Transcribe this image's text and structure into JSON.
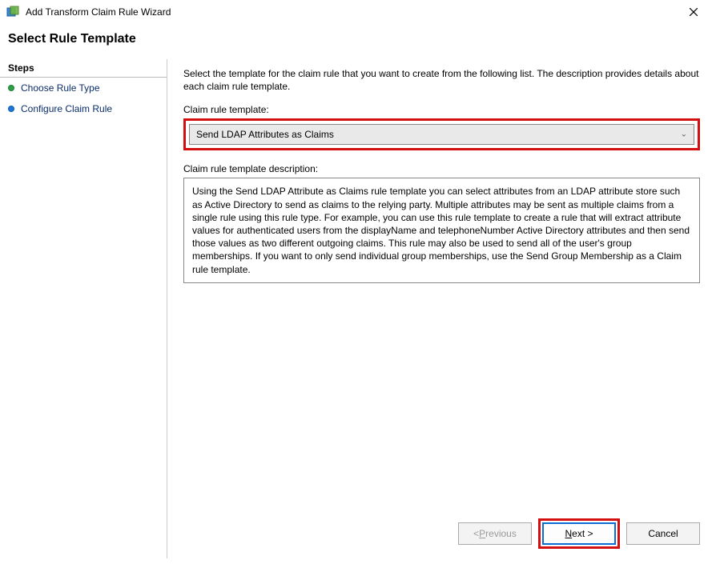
{
  "window": {
    "title": "Add Transform Claim Rule Wizard"
  },
  "header": {
    "title": "Select Rule Template"
  },
  "sidebar": {
    "heading": "Steps",
    "items": [
      {
        "label": "Choose Rule Type"
      },
      {
        "label": "Configure Claim Rule"
      }
    ]
  },
  "main": {
    "intro": "Select the template for the claim rule that you want to create from the following list. The description provides details about each claim rule template.",
    "template_field_label": "Claim rule template:",
    "template_value": "Send LDAP Attributes as Claims",
    "description_label": "Claim rule template description:",
    "description_text": "Using the Send LDAP Attribute as Claims rule template you can select attributes from an LDAP attribute store such as Active Directory to send as claims to the relying party. Multiple attributes may be sent as multiple claims from a single rule using this rule type. For example, you can use this rule template to create a rule that will extract attribute values for authenticated users from the displayName and telephoneNumber Active Directory attributes and then send those values as two different outgoing claims. This rule may also be used to send all of the user's group memberships. If you want to only send individual group memberships, use the Send Group Membership as a Claim rule template."
  },
  "buttons": {
    "previous_prefix": "< ",
    "previous_mnemonic": "P",
    "previous_suffix": "revious",
    "next_prefix": "",
    "next_mnemonic": "N",
    "next_suffix": "ext >",
    "cancel": "Cancel"
  }
}
